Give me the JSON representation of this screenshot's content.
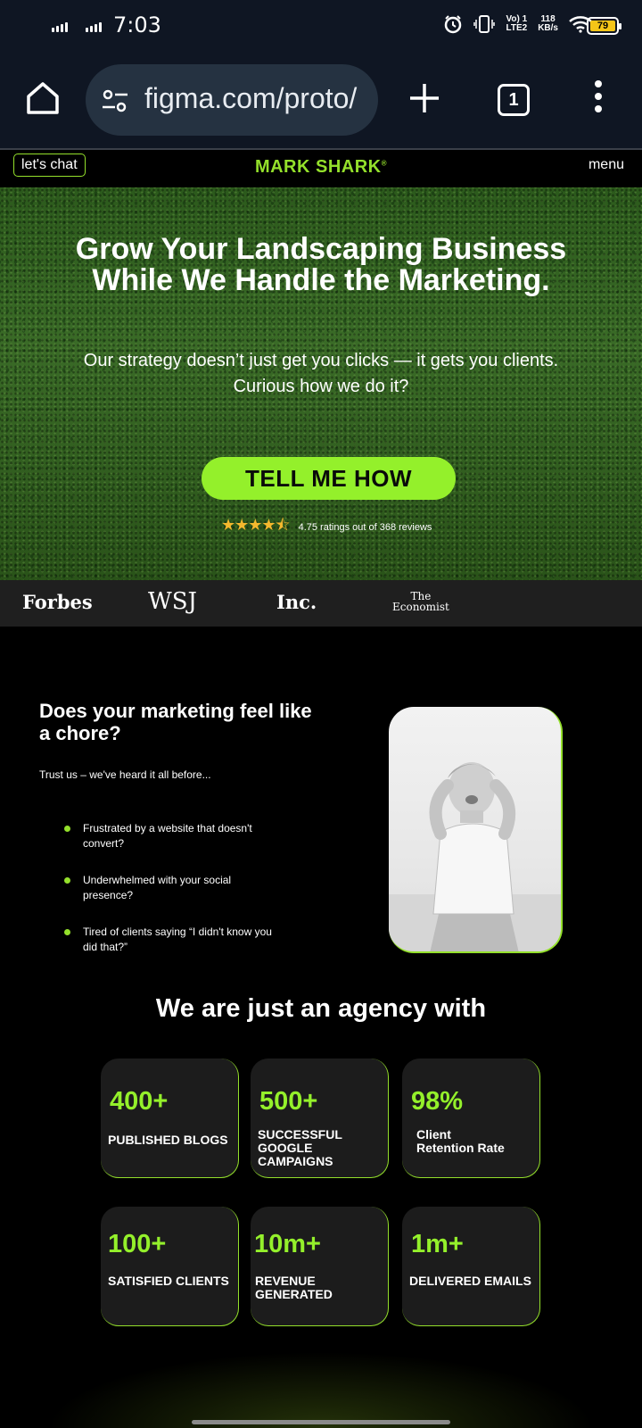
{
  "status_bar": {
    "time": "7:03",
    "network": "Vo) 1\nLTE2",
    "speed": "118\nKB/s",
    "battery": "79"
  },
  "browser": {
    "url": "figma.com/proto/",
    "tab_count": "1"
  },
  "site_nav": {
    "chat_label": "let's chat",
    "brand": "MARK SHARK",
    "brand_mark": "®",
    "menu_label": "menu"
  },
  "hero": {
    "title": "Grow Your Landscaping Business While We Handle the Marketing.",
    "subtitle_line1": "Our strategy doesn’t just get you clicks — it gets you clients.",
    "subtitle_line2": "Curious how we do it?",
    "cta_label": "TELL ME HOW",
    "rating_value": 4.75,
    "rating_text": "4.75 ratings out of 368 reviews"
  },
  "press": {
    "forbes": "Forbes",
    "wsj": "WSJ",
    "inc": "Inc.",
    "economist_line1": "The",
    "economist_line2": "Economist"
  },
  "chore": {
    "title": "Does your marketing feel like a chore?",
    "intro": "Trust us – we've heard it all before...",
    "bullets": [
      "Frustrated by a website that doesn't convert?",
      "Underwhelmed with your social presence?",
      "Tired of clients saying “I didn't know you did that?”"
    ]
  },
  "agency": {
    "title": "We are just an agency with",
    "stats": [
      {
        "number": "400+",
        "label": "PUBLISHED BLOGS"
      },
      {
        "number": "500+",
        "label": "SUCCESSFUL GOOGLE CAMPAIGNS"
      },
      {
        "number": "98%",
        "label": "Client Retention Rate"
      },
      {
        "number": "100+",
        "label": "SATISFIED CLIENTS"
      },
      {
        "number": "10m+",
        "label": "REVENUE GENERATED"
      },
      {
        "number": "1m+",
        "label": "DELIVERED EMAILS"
      }
    ]
  },
  "colors": {
    "accent_green": "#94f02b",
    "star": "#f5b82e",
    "card_bg": "#1c1c1c"
  }
}
